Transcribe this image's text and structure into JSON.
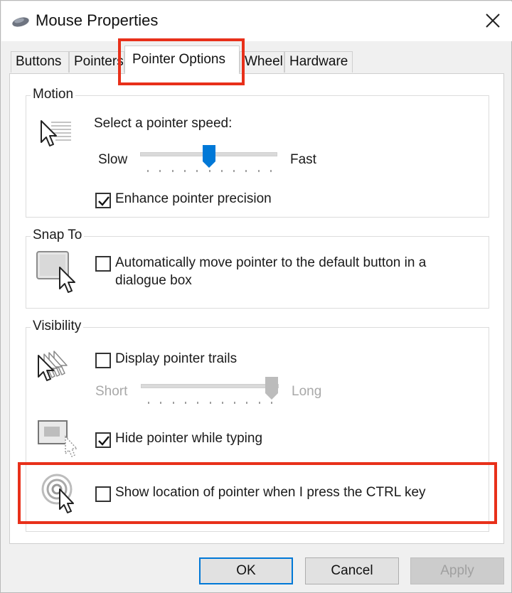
{
  "window": {
    "title": "Mouse Properties",
    "close_icon": "close-icon"
  },
  "tabs": [
    {
      "label": "Buttons"
    },
    {
      "label": "Pointers"
    },
    {
      "label": "Pointer Options",
      "active": true
    },
    {
      "label": "Wheel"
    },
    {
      "label": "Hardware"
    }
  ],
  "motion": {
    "group_label": "Motion",
    "speed_label": "Select a pointer speed:",
    "slow_label": "Slow",
    "fast_label": "Fast",
    "speed_value_fraction": 0.5,
    "enhance_precision_label": "Enhance pointer precision",
    "enhance_precision_checked": true
  },
  "snap_to": {
    "group_label": "Snap To",
    "auto_move_label": "Automatically move pointer to the default button in a dialogue box",
    "auto_move_checked": false
  },
  "visibility": {
    "group_label": "Visibility",
    "trails_label": "Display pointer trails",
    "trails_checked": false,
    "short_label": "Short",
    "long_label": "Long",
    "trails_length_fraction": 1.0,
    "hide_typing_label": "Hide pointer while typing",
    "hide_typing_checked": true,
    "show_location_label": "Show location of pointer when I press the CTRL key",
    "show_location_checked": false
  },
  "buttons": {
    "ok": "OK",
    "cancel": "Cancel",
    "apply": "Apply"
  },
  "colors": {
    "highlight": "#e8301a",
    "accent": "#0078d7"
  }
}
